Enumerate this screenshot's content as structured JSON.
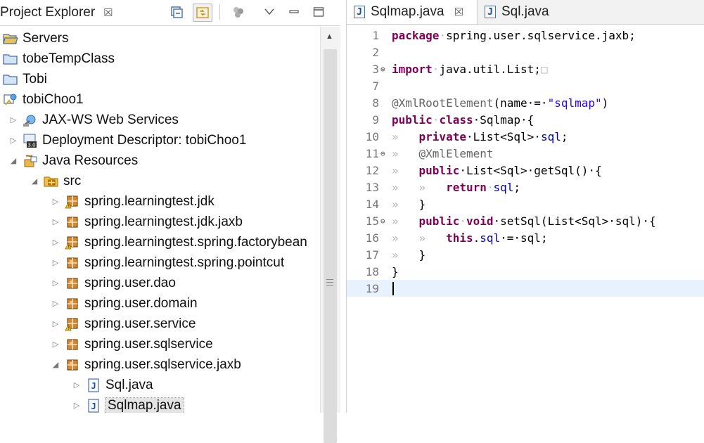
{
  "explorer": {
    "tab_label": "Project Explorer",
    "close_glyph": "☒",
    "toolbar": [
      "collapse-all-icon",
      "link-with-editor-icon",
      "filters-icon",
      "view-menu-icon",
      "minimize-icon",
      "maximize-icon"
    ]
  },
  "tree": [
    {
      "label": "Servers",
      "icon": "folder-open-icon",
      "expander": ""
    },
    {
      "label": "tobeTempClass",
      "icon": "project-icon",
      "expander": ""
    },
    {
      "label": "Tobi",
      "icon": "project-icon",
      "expander": ""
    },
    {
      "label": "tobiChoo1",
      "icon": "web-project-icon",
      "expander": ""
    },
    {
      "label": "JAX-WS Web Services",
      "icon": "web-services-icon",
      "expander": "▷"
    },
    {
      "label": "Deployment Descriptor: tobiChoo1",
      "icon": "deployment-descriptor-icon",
      "expander": "▷"
    },
    {
      "label": "Java Resources",
      "icon": "java-resources-icon",
      "expander": "◢"
    },
    {
      "label": "src",
      "icon": "source-folder-icon",
      "expander": "◢"
    },
    {
      "label": "spring.learningtest.jdk",
      "icon": "package-warning-icon",
      "expander": "▷"
    },
    {
      "label": "spring.learningtest.jdk.jaxb",
      "icon": "package-icon",
      "expander": "▷"
    },
    {
      "label": "spring.learningtest.spring.factorybean",
      "icon": "package-warning-icon",
      "expander": "▷"
    },
    {
      "label": "spring.learningtest.spring.pointcut",
      "icon": "package-icon",
      "expander": "▷"
    },
    {
      "label": "spring.user.dao",
      "icon": "package-icon",
      "expander": "▷"
    },
    {
      "label": "spring.user.domain",
      "icon": "package-icon",
      "expander": "▷"
    },
    {
      "label": "spring.user.service",
      "icon": "package-warning-icon",
      "expander": "▷"
    },
    {
      "label": "spring.user.sqlservice",
      "icon": "package-icon",
      "expander": "▷"
    },
    {
      "label": "spring.user.sqlservice.jaxb",
      "icon": "package-icon",
      "expander": "◢"
    },
    {
      "label": "Sql.java",
      "icon": "java-file-icon",
      "expander": "▷"
    },
    {
      "label": "Sqlmap.java",
      "icon": "java-file-icon",
      "expander": "▷",
      "selected": true
    }
  ],
  "editor": {
    "tabs": [
      {
        "label": "Sqlmap.java",
        "icon_glyph": "J",
        "close_glyph": "☒",
        "active": true
      },
      {
        "label": "Sql.java",
        "icon_glyph": "J",
        "active": false
      }
    ],
    "lines": [
      {
        "num": "1",
        "marker": "",
        "tokens": [
          {
            "t": "package",
            "c": "kw"
          },
          {
            "t": "·",
            "c": "ws"
          },
          {
            "t": "spring.user.sqlservice.jaxb;",
            "c": ""
          }
        ]
      },
      {
        "num": "2",
        "marker": "",
        "tokens": []
      },
      {
        "num": "3",
        "marker": "⊕",
        "tokens": [
          {
            "t": "import",
            "c": "kw"
          },
          {
            "t": "·",
            "c": "ws"
          },
          {
            "t": "java.util.List;",
            "c": ""
          },
          {
            "t": "□",
            "c": "ws"
          }
        ]
      },
      {
        "num": "7",
        "marker": "",
        "tokens": []
      },
      {
        "num": "8",
        "marker": "",
        "tokens": [
          {
            "t": "@XmlRootElement",
            "c": "ann"
          },
          {
            "t": "(name·=·",
            "c": ""
          },
          {
            "t": "\"sqlmap\"",
            "c": "str"
          },
          {
            "t": ")",
            "c": ""
          }
        ]
      },
      {
        "num": "9",
        "marker": "",
        "tokens": [
          {
            "t": "public",
            "c": "kw"
          },
          {
            "t": "·",
            "c": "ws"
          },
          {
            "t": "class",
            "c": "kw"
          },
          {
            "t": "·Sqlmap·{",
            "c": ""
          }
        ]
      },
      {
        "num": "10",
        "marker": "",
        "tokens": [
          {
            "t": "»   ",
            "c": "ws"
          },
          {
            "t": "private",
            "c": "kw"
          },
          {
            "t": "·List<Sql>·",
            "c": ""
          },
          {
            "t": "sql",
            "c": "fld"
          },
          {
            "t": ";",
            "c": ""
          }
        ]
      },
      {
        "num": "11",
        "marker": "⊖",
        "tokens": [
          {
            "t": "»   ",
            "c": "ws"
          },
          {
            "t": "@XmlElement",
            "c": "ann"
          }
        ]
      },
      {
        "num": "12",
        "marker": "",
        "tokens": [
          {
            "t": "»   ",
            "c": "ws"
          },
          {
            "t": "public",
            "c": "kw"
          },
          {
            "t": "·List<Sql>·getSql()·{",
            "c": ""
          }
        ]
      },
      {
        "num": "13",
        "marker": "",
        "tokens": [
          {
            "t": "»   »   ",
            "c": "ws"
          },
          {
            "t": "return",
            "c": "kw"
          },
          {
            "t": "·",
            "c": "ws"
          },
          {
            "t": "sql",
            "c": "fld"
          },
          {
            "t": ";",
            "c": ""
          }
        ]
      },
      {
        "num": "14",
        "marker": "",
        "tokens": [
          {
            "t": "»   ",
            "c": "ws"
          },
          {
            "t": "}",
            "c": ""
          }
        ]
      },
      {
        "num": "15",
        "marker": "⊖",
        "tokens": [
          {
            "t": "»   ",
            "c": "ws"
          },
          {
            "t": "public",
            "c": "kw"
          },
          {
            "t": "·",
            "c": "ws"
          },
          {
            "t": "void",
            "c": "kw"
          },
          {
            "t": "·setSql(List<Sql>·sql)·{",
            "c": ""
          }
        ]
      },
      {
        "num": "16",
        "marker": "",
        "tokens": [
          {
            "t": "»   »   ",
            "c": "ws"
          },
          {
            "t": "this",
            "c": "kw"
          },
          {
            "t": ".",
            "c": ""
          },
          {
            "t": "sql",
            "c": "fld"
          },
          {
            "t": "·=·sql;",
            "c": ""
          }
        ]
      },
      {
        "num": "17",
        "marker": "",
        "tokens": [
          {
            "t": "»   ",
            "c": "ws"
          },
          {
            "t": "}",
            "c": ""
          }
        ]
      },
      {
        "num": "18",
        "marker": "",
        "tokens": [
          {
            "t": "}",
            "c": ""
          }
        ]
      },
      {
        "num": "19",
        "marker": "",
        "tokens": [],
        "current": true
      }
    ]
  },
  "colors": {
    "keyword": "#7f0055",
    "annotation": "#646464",
    "string": "#2a00ff",
    "field": "#0000c0",
    "line_number": "#787878"
  }
}
